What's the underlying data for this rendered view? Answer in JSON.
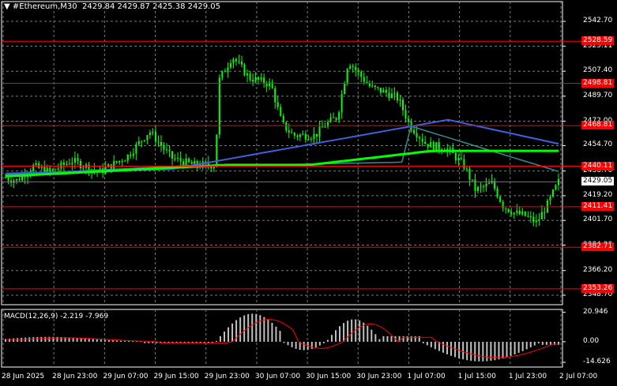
{
  "header": {
    "menu_glyph": "▼",
    "symbol": "#Ethereum,M30",
    "ohlc": "2429.84 2429.87 2425.38 2429.05"
  },
  "price_axis": {
    "labels": [
      "2542.70",
      "2525.11",
      "2507.40",
      "2489.70",
      "2472.00",
      "2454.70",
      "2436.70",
      "2419.20",
      "2401.70",
      "2384.20",
      "2366.20",
      "2348.70"
    ],
    "values": [
      2542.7,
      2525.11,
      2507.4,
      2489.7,
      2472.0,
      2454.7,
      2436.7,
      2419.2,
      2401.7,
      2384.2,
      2366.2,
      2348.7
    ],
    "range": [
      2342,
      2550
    ]
  },
  "current_price": {
    "label": "2429.05",
    "value": 2429.05,
    "bg": "#ffffff",
    "fg": "#000000"
  },
  "levels": [
    {
      "label": "2528.59",
      "value": 2528.59
    },
    {
      "label": "2498.81",
      "value": 2498.81
    },
    {
      "label": "2468.81",
      "value": 2468.81
    },
    {
      "label": "2440.11",
      "value": 2440.11
    },
    {
      "label": "2411.41",
      "value": 2411.41
    },
    {
      "label": "2382.71",
      "value": 2382.71
    },
    {
      "label": "2353.26",
      "value": 2353.26
    }
  ],
  "level_color": "#ff0000",
  "time_axis": {
    "labels": [
      "28 Jun 2025",
      "28 Jun 23:00",
      "29 Jun 07:00",
      "29 Jun 15:00",
      "29 Jun 23:00",
      "30 Jun 07:00",
      "30 Jun 15:00",
      "30 Jun 23:00",
      "1 Jul 07:00",
      "1 Jul 15:00",
      "1 Jul 23:00",
      "2 Jul 07:00"
    ]
  },
  "macd": {
    "label": "MACD(12,26,9) -2.219 -7.969",
    "axis_labels": [
      "20.946",
      "0.00",
      "-14.626"
    ],
    "axis_values": [
      20.946,
      0,
      -14.626
    ],
    "range": [
      -18,
      23
    ]
  },
  "colors": {
    "background": "#000000",
    "grid": "#7a7a7a",
    "candles": "#00ff00",
    "ma_fast": "#2f8f8f",
    "ma_mid": "#4060e0",
    "ma_slow": "#00ff00",
    "macd_hist": "#c0c0c0",
    "macd_signal": "#ff0000"
  }
}
